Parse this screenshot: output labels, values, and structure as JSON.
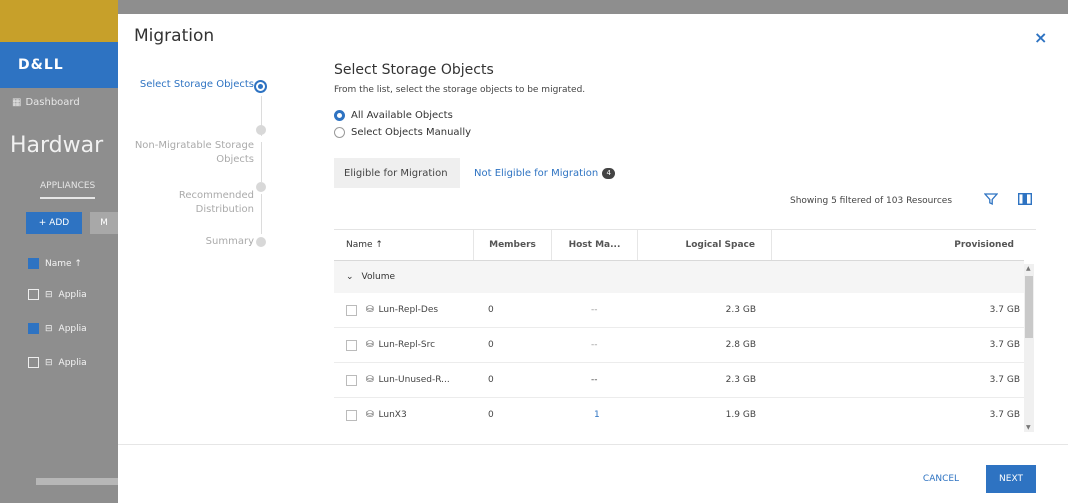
{
  "background": {
    "logo": "D&LL",
    "dashboard": "Dashboard",
    "page_title": "Hardwar",
    "appliances_tab": "APPLIANCES",
    "add_button": "+ ADD",
    "more_button": "M",
    "name_header": "Name ↑",
    "rows": [
      "Applia",
      "Applia",
      "Applia"
    ]
  },
  "dialog": {
    "title": "Migration",
    "close": "×"
  },
  "steps": [
    {
      "label": "Select Storage Objects",
      "active": true
    },
    {
      "label": "Non-Migratable Storage Objects",
      "active": false
    },
    {
      "label": "Recommended Distribution",
      "active": false
    },
    {
      "label": "Summary",
      "active": false
    }
  ],
  "section": {
    "title": "Select Storage Objects",
    "description": "From the list, select the storage objects to be migrated."
  },
  "radios": [
    {
      "label": "All Available Objects",
      "selected": true
    },
    {
      "label": "Select Objects Manually",
      "selected": false
    }
  ],
  "tabs": {
    "eligible": "Eligible for Migration",
    "not_eligible": "Not Eligible for Migration",
    "not_eligible_count": "4"
  },
  "showing": "Showing 5 filtered of 103 Resources",
  "table": {
    "headers": {
      "name": "Name ↑",
      "members": "Members",
      "host": "Host Ma...",
      "logical": "Logical Space",
      "provisioned": "Provisioned"
    },
    "group": "Volume",
    "rows": [
      {
        "name": "Lun-Repl-Des",
        "members": "0",
        "host": "--",
        "logical": "2.3 GB",
        "provisioned": "3.7 GB"
      },
      {
        "name": "Lun-Repl-Src",
        "members": "0",
        "host": "--",
        "logical": "2.8 GB",
        "provisioned": "3.7 GB"
      },
      {
        "name": "Lun-Unused-R...",
        "members": "0",
        "host": "--",
        "logical": "2.3 GB",
        "provisioned": "3.7 GB"
      },
      {
        "name": "LunX3",
        "members": "0",
        "host": "1",
        "logical": "1.9 GB",
        "provisioned": "3.7 GB"
      }
    ]
  },
  "footer": {
    "cancel": "CANCEL",
    "next": "NEXT"
  },
  "colors": {
    "accent": "#2e73c2",
    "overlay": "#8e8e8e"
  }
}
